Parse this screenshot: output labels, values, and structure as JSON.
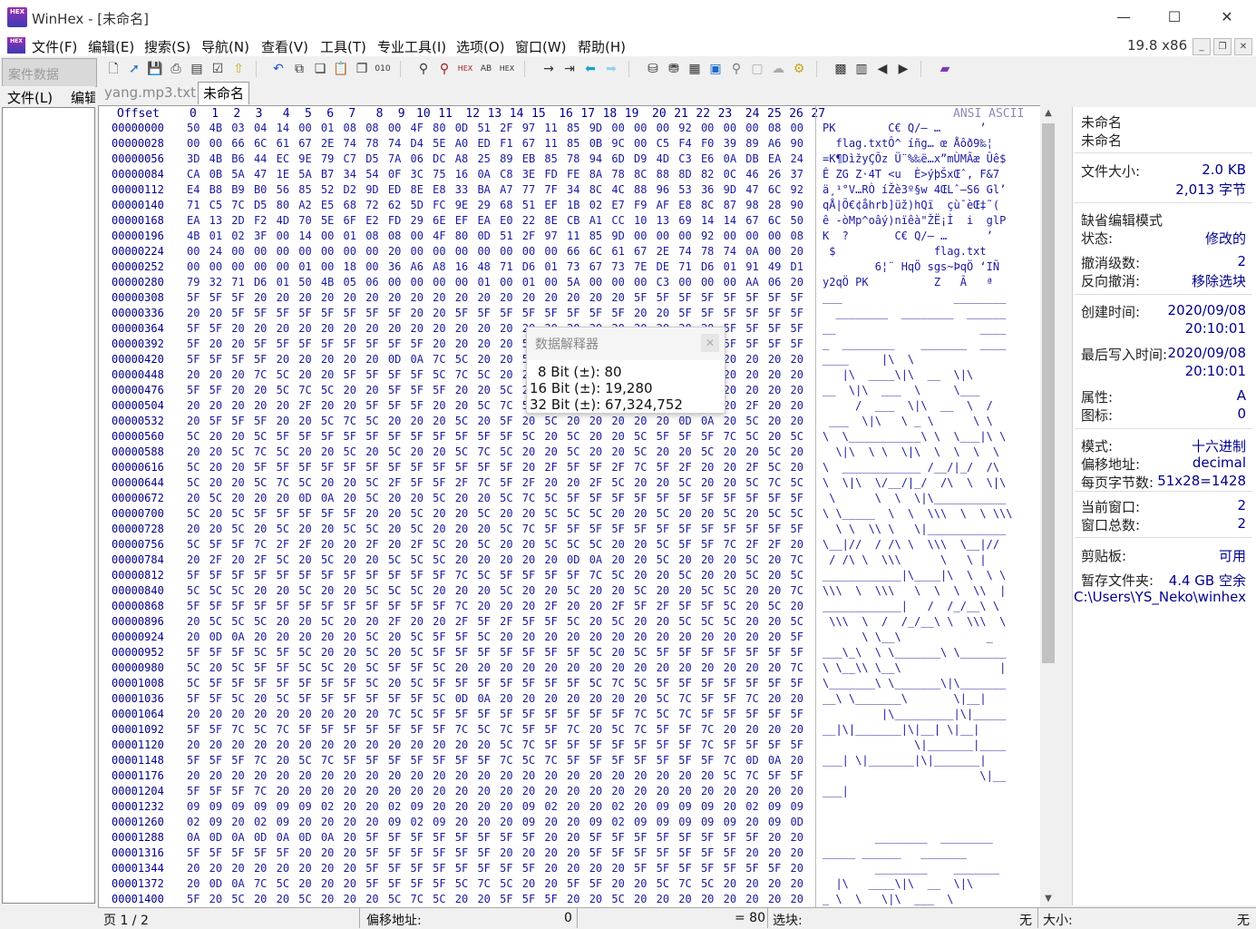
{
  "window": {
    "title": "WinHex - [未命名]",
    "minimize": "—",
    "maximize": "☐",
    "close": "✕",
    "version": "19.8 x86",
    "app_icon_text": "HEX"
  },
  "menu": [
    "文件(F)",
    "编辑(E)",
    "搜索(S)",
    "导航(N)",
    "查看(V)",
    "工具(T)",
    "专业工具(I)",
    "选项(O)",
    "窗口(W)",
    "帮助(H)"
  ],
  "case_pane": {
    "title": "案件数据",
    "menu_file": "文件(L)",
    "menu_edit": "编辑"
  },
  "tabs": [
    "yang.mp3.txt",
    "未命名"
  ],
  "hex": {
    "offset_label": "Offset",
    "columns": [
      "0",
      "1",
      "2",
      "3",
      "4",
      "5",
      "6",
      "7",
      "8",
      "9",
      "10",
      "11",
      "12",
      "13",
      "14",
      "15",
      "16",
      "17",
      "18",
      "19",
      "20",
      "21",
      "22",
      "23",
      "24",
      "25",
      "26",
      "27"
    ],
    "ascii_label": "ANSI ASCII",
    "rows": [
      {
        "o": "00000000",
        "h": "50 4B 03 04 14 00 01 08 08 00 4F 80 0D 51 2F 97 11 85 9D 00 00 00 92 00 00 00 08 00",
        "a": "PK        C€ Q/– …      ’"
      },
      {
        "o": "00000028",
        "h": "00 00 66 6C 61 67 2E 74 78 74 D4 5E A0 ED F1 67 11 85 0B 9C 00 C5 F4 F0 39 89 A6 90",
        "a": "  flag.txtÔ^ íñg… œ Åôð9‰¦"
      },
      {
        "o": "00000056",
        "h": "3D 4B B6 44 EC 9E 79 C7 D5 7A 06 DC A8 25 89 EB 85 78 94 6D D9 4D C3 E6 0A DB EA 24",
        "a": "=K¶DìžyÇÕz Ü¨%‰ë…x”mÙMÃæ Ûê$"
      },
      {
        "o": "00000084",
        "h": "CA 0B 5A 47 1E 5A B7 34 54 0F 3C 75 16 0A C8 3E FD FE 8A 78 8C 88 8D 82 0C 46 26 37",
        "a": "Ê ZG Z·4T <u  È>ýþŠxŒˆ‚ F&7"
      },
      {
        "o": "00000112",
        "h": "E4 B8 B9 B0 56 85 52 D2 9D ED 8E E8 33 BA A7 77 7F 34 8C 4C 88 96 53 36 9D 47 6C 92",
        "a": "ä¸¹°V…RÒ íŽè3º§w 4ŒLˆ–S6 Gl’"
      },
      {
        "o": "00000140",
        "h": "71 C5 7C D5 80 A2 E5 68 72 62 5D FC 9E 29 68 51 EF 1B 02 E7 F9 AF E8 8C 87 98 28 90",
        "a": "qÅ|Õ€¢åhrb]üž)hQï  çù¯èŒ‡˜("
      },
      {
        "o": "00000168",
        "h": "EA 13 2D F2 4D 70 5E 6F E2 FD 29 6E EF EA E0 22 8E CB A1 CC 10 13 69 14 14 67 6C 50",
        "a": "ê -òMp^oâý)nïêà\"ŽË¡Ì  i  glP"
      },
      {
        "o": "00000196",
        "h": "4B 01 02 3F 00 14 00 01 08 08 00 4F 80 0D 51 2F 97 11 85 9D 00 00 00 92 00 00 00 08",
        "a": "K  ?       C€ Q/– …      ’"
      },
      {
        "o": "00000224",
        "h": "00 24 00 00 00 00 00 00 00 20 00 00 00 00 00 00 00 66 6C 61 67 2E 74 78 74 0A 00 20",
        "a": " $               flag.txt"
      },
      {
        "o": "00000252",
        "h": "00 00 00 00 00 01 00 18 00 36 A6 A8 16 48 71 D6 01 73 67 73 7E DE 71 D6 01 91 49 D1",
        "a": "        6¦¨ HqÖ sgs~ÞqÖ ‘IÑ"
      },
      {
        "o": "00000280",
        "h": "79 32 71 D6 01 50 4B 05 06 00 00 00 00 01 00 01 00 5A 00 00 00 C3 00 00 00 AA 06 20",
        "a": "y2qÖ PK          Z   Ã   ª"
      },
      {
        "o": "00000308",
        "h": "5F 5F 5F 20 20 20 20 20 20 20 20 20 20 20 20 20 20 20 20 20 5F 5F 5F 5F 5F 5F 5F 5F",
        "a": "___                 ________"
      },
      {
        "o": "00000336",
        "h": "20 20 5F 5F 5F 5F 5F 5F 5F 5F 20 20 5F 5F 5F 5F 5F 5F 5F 5F 20 20 5F 5F 5F 5F 5F 5F",
        "a": "  ________  ________  ______"
      },
      {
        "o": "00000364",
        "h": "5F 5F 20 20 20 20 20 20 20 20 20 20 20 20 20 20 20 20 20 20 20 20 20 20 5F 5F 5F 5F",
        "a": "__                      ____"
      },
      {
        "o": "00000392",
        "h": "5F 20 20 5F 5F 5F 5F 5F 5F 5F 5F 20 20 20 20 5F 5F 5F 5F 5F 5F 5F 20 20 5F 5F 5F 5F",
        "a": "_  ________    _______  ____"
      },
      {
        "o": "00000420",
        "h": "5F 5F 5F 5F 20 20 20 20 20 0D 0A 7C 5C 20 20 5C 20 20 20 20 20 20 20 20 20 20 20 20",
        "a": "____     |\\  \\"
      },
      {
        "o": "00000448",
        "h": "20 20 20 7C 5C 20 20 5F 5F 5F 5F 5C 7C 5C 20 20 5F 5F 20 20 5C 7C 5C 20 20 20 20 20",
        "a": "   |\\  ____\\|\\  __  \\|\\"
      },
      {
        "o": "00000476",
        "h": "5F 5F 20 20 5C 7C 5C 20 20 5F 5F 5F 20 20 5C 20 20 20 20 20 5C 5F 5F 5F 20 20 20 20",
        "a": "__  \\|\\  ___  \\     \\___"
      },
      {
        "o": "00000504",
        "h": "20 20 20 20 20 2F 20 20 5F 5F 5F 20 20 5C 7C 5C 20 20 5F 5F 20 20 5C 20 20 2F 20 20",
        "a": "     /  ___  \\|\\  __  \\  /"
      },
      {
        "o": "00000532",
        "h": "20 5F 5F 5F 20 20 5C 7C 5C 20 20 20 5C 20 5F 20 5C 20 20 20 20 20 0D 0A 20 5C 20 20",
        "a": " ___  \\|\\   \\ _ \\      \\ \\"
      },
      {
        "o": "00000560",
        "h": "5C 20 20 5C 5F 5F 5F 5F 5F 5F 5F 5F 5F 5F 5F 5C 20 5C 20 20 5C 5F 5F 5F 7C 5C 20 5C",
        "a": "\\  \\___________\\ \\  \\___|\\ \\"
      },
      {
        "o": "00000588",
        "h": "20 20 5C 7C 5C 20 20 5C 20 5C 20 20 5C 7C 5C 20 20 5C 20 20 5C 20 20 5C 20 20 5C 20",
        "a": "  \\|\\  \\ \\  \\|\\  \\  \\  \\  \\"
      },
      {
        "o": "00000616",
        "h": "5C 20 20 5F 5F 5F 5F 5F 5F 5F 5F 5F 5F 5F 5F 20 2F 5F 5F 2F 7C 5F 2F 20 20 2F 5C 20",
        "a": "\\  ____________ /__/|_/  /\\"
      },
      {
        "o": "00000644",
        "h": "5C 20 20 5C 7C 5C 20 20 5C 2F 5F 5F 2F 7C 5F 2F 20 20 2F 5C 20 20 5C 20 20 5C 7C 5C",
        "a": "\\  \\|\\  \\/__/|_/  /\\  \\  \\|\\"
      },
      {
        "o": "00000672",
        "h": "20 5C 20 20 20 0D 0A 20 5C 20 20 5C 20 20 5C 7C 5C 5F 5F 5F 5F 5F 5F 5F 5F 5F 5F 5F",
        "a": " \\      \\  \\  \\|\\___________"
      },
      {
        "o": "00000700",
        "h": "5C 20 5C 5F 5F 5F 5F 5F 20 20 5C 20 20 5C 20 20 5C 5C 5C 20 20 5C 20 20 5C 20 5C 5C",
        "a": "\\ \\_____  \\  \\  \\\\\\  \\  \\ \\\\\\"
      },
      {
        "o": "00000728",
        "h": "20 20 5C 20 5C 20 20 5C 5C 20 5C 20 20 20 5C 7C 5F 5F 5F 5F 5F 5F 5F 5F 5F 5F 5F 5F",
        "a": "  \\ \\  \\\\ \\   \\|____________"
      },
      {
        "o": "00000756",
        "h": "5C 5F 5F 7C 2F 2F 20 20 2F 20 2F 5C 20 5C 20 20 5C 5C 5C 20 20 5C 5F 5F 7C 2F 2F 20",
        "a": "\\__|//  / /\\ \\  \\\\\\  \\__|//"
      },
      {
        "o": "00000784",
        "h": "20 2F 20 2F 5C 20 5C 20 20 5C 5C 5C 20 20 20 20 20 0D 0A 20 20 5C 20 20 20 5C 20 7C",
        "a": " / /\\ \\  \\\\\\      \\   \\ |"
      },
      {
        "o": "00000812",
        "h": "5F 5F 5F 5F 5F 5F 5F 5F 5F 5F 5F 5F 7C 5C 5F 5F 5F 5F 7C 5C 20 20 5C 20 20 5C 20 5C",
        "a": "____________|\\____|\\  \\  \\ \\"
      },
      {
        "o": "00000840",
        "h": "5C 5C 5C 20 20 5C 20 20 5C 5C 5C 20 20 20 5C 20 20 5C 20 20 5C 20 20 5C 5C 20 20 7C",
        "a": "\\\\\\  \\  \\\\\\   \\  \\  \\  \\\\  |"
      },
      {
        "o": "00000868",
        "h": "5F 5F 5F 5F 5F 5F 5F 5F 5F 5F 5F 5F 7C 20 20 20 2F 20 20 2F 5F 2F 5F 5F 5C 20 5C 20",
        "a": "____________|   /  /_/__\\ \\"
      },
      {
        "o": "00000896",
        "h": "20 5C 5C 5C 20 20 5C 20 20 2F 20 20 2F 5F 2F 5F 5F 5C 20 5C 20 20 5C 5C 5C 20 20 5C",
        "a": " \\\\\\  \\  /  /_/__\\ \\  \\\\\\  \\"
      },
      {
        "o": "00000924",
        "h": "20 0D 0A 20 20 20 20 20 5C 20 5C 5F 5F 5C 20 20 20 20 20 20 20 20 20 20 20 20 20 5F",
        "a": "      \\ \\__\\             _"
      },
      {
        "o": "00000952",
        "h": "5F 5F 5F 5C 5F 5C 20 20 5C 20 5C 5F 5F 5F 5F 5F 5F 5F 5C 20 5C 5F 5F 5F 5F 5F 5F 5F",
        "a": "___\\_\\  \\ \\_______\\ \\_______"
      },
      {
        "o": "00000980",
        "h": "5C 20 5C 5F 5F 5C 5C 20 5C 5F 5F 5C 20 20 20 20 20 20 20 20 20 20 20 20 20 20 20 7C",
        "a": "\\ \\__\\\\ \\__\\               |"
      },
      {
        "o": "00001008",
        "h": "5C 5F 5F 5F 5F 5F 5F 5F 5C 20 5C 5F 5F 5F 5F 5F 5F 5F 5C 7C 5C 5F 5F 5F 5F 5F 5F 5F",
        "a": "\\_______\\ \\_______\\|\\_______"
      },
      {
        "o": "00001036",
        "h": "5F 5F 5C 20 5C 5F 5F 5F 5F 5F 5F 5C 0D 0A 20 20 20 20 20 20 20 5C 7C 5F 5F 7C 20 20",
        "a": "__\\ \\_______\\       \\|__|"
      },
      {
        "o": "00001064",
        "h": "20 20 20 20 20 20 20 20 20 7C 5C 5F 5F 5F 5F 5F 5F 5F 5F 5F 7C 5C 7C 5F 5F 5F 5F 5F",
        "a": "         |\\_________|\\|_____"
      },
      {
        "o": "00001092",
        "h": "5F 5F 7C 5C 7C 5F 5F 5F 5F 5F 5F 5F 7C 5C 7C 5F 5F 7C 20 5C 7C 5F 5F 7C 20 20 20 20",
        "a": "__|\\|_______|\\|__| \\|__|"
      },
      {
        "o": "00001120",
        "h": "20 20 20 20 20 20 20 20 20 20 20 20 20 20 5C 7C 5F 5F 5F 5F 5F 5F 5F 7C 5F 5F 5F 5F",
        "a": "              \\|_______|____"
      },
      {
        "o": "00001148",
        "h": "5F 5F 5F 7C 20 5C 7C 5F 5F 5F 5F 5F 5F 5F 7C 5C 7C 5F 5F 5F 5F 5F 5F 5F 7C 0D 0A 20",
        "a": "___| \\|_______|\\|_______|"
      },
      {
        "o": "00001176",
        "h": "20 20 20 20 20 20 20 20 20 20 20 20 20 20 20 20 20 20 20 20 20 20 20 20 5C 7C 5F 5F",
        "a": "                        \\|__"
      },
      {
        "o": "00001204",
        "h": "5F 5F 5F 7C 20 20 20 20 20 20 20 20 20 20 20 20 20 20 20 20 20 20 20 20 20 20 20 20",
        "a": "___|"
      },
      {
        "o": "00001232",
        "h": "09 09 09 09 09 09 02 20 20 02 09 20 20 20 20 09 02 20 20 02 20 09 09 09 20 02 09 09",
        "a": ""
      },
      {
        "o": "00001260",
        "h": "02 09 20 02 09 20 20 20 20 09 02 09 20 20 20 09 20 20 09 02 09 09 09 09 09 20 09 0D",
        "a": ""
      },
      {
        "o": "00001288",
        "h": "0A 0D 0A 0D 0A 0D 0A 20 5F 5F 5F 5F 5F 5F 5F 5F 20 20 5F 5F 5F 5F 5F 5F 5F 5F 20 20",
        "a": "        ________  ________"
      },
      {
        "o": "00001316",
        "h": "5F 5F 5F 5F 5F 20 20 20 5F 5F 5F 5F 5F 5F 20 20 20 20 5F 5F 5F 5F 5F 5F 5F 20 20 20",
        "a": "_____ ______   _______"
      },
      {
        "o": "00001344",
        "h": "20 20 20 20 20 20 20 20 5F 5F 5F 5F 5F 5F 5F 5F 20 20 20 20 5F 5F 5F 5F 5F 5F 5F 20",
        "a": "        ________    _______"
      },
      {
        "o": "00001372",
        "h": "20 0D 0A 7C 5C 20 20 20 5F 5F 5F 5F 5C 7C 5C 20 20 5F 5F 20 20 5C 7C 5C 20 20 20 20",
        "a": "  |\\   ____\\|\\  __  \\|\\"
      },
      {
        "o": "00001400",
        "h": "5F 20 5C 20 20 5C 20 20 20 5C 7C 5C 20 20 5F 5F 5F 20 20 5C 20 20 20 20 20 20 20 20",
        "a": "_ \\  \\   \\|\\  ___  \\"
      }
    ]
  },
  "interpreter": {
    "title": "数据解释器",
    "close": "✕",
    "rows": [
      "8 Bit (±): 80",
      "16 Bit (±): 19,280",
      "32 Bit (±): 67,324,752"
    ]
  },
  "info": {
    "name1": "未命名",
    "name2": "未命名",
    "filesize_label": "文件大小:",
    "filesize_kb": "2.0 KB",
    "filesize_bytes": "2,013 字节",
    "edit_mode_label": "缺省编辑模式",
    "state_label": "状态:",
    "state_value": "修改的",
    "undo_label": "撤消级数:",
    "undo_value": "2",
    "redo_label": "反向撤消:",
    "redo_value": "移除选块",
    "created_label": "创建时间:",
    "created_date": "2020/09/08",
    "created_time": "20:10:01",
    "written_label": "最后写入时间:",
    "written_date": "2020/09/08",
    "written_time": "20:10:01",
    "attr_label": "属性:",
    "attr_value": "A",
    "icon_label": "图标:",
    "icon_value": "0",
    "mode_label": "模式:",
    "mode_value": "十六进制",
    "offset_label": "偏移地址:",
    "offset_value": "decimal",
    "bpp_label": "每页字节数:",
    "bpp_value": "51x28=1428",
    "curwin_label": "当前窗口:",
    "curwin_value": "2",
    "totalwin_label": "窗口总数:",
    "totalwin_value": "2",
    "clip_label": "剪贴板:",
    "clip_value": "可用",
    "temp_label": "暂存文件夹:",
    "temp_value": "4.4 GB 空余",
    "temp_path": "C:\\Users\\YS_Neko\\winhex"
  },
  "status": {
    "page": "页 1 / 2",
    "offset_label": "偏移地址:",
    "offset_value": "0",
    "equals": "= 80",
    "block_label": "选块:",
    "block_value": "无",
    "size_label": "大小:",
    "size_value": "无"
  }
}
